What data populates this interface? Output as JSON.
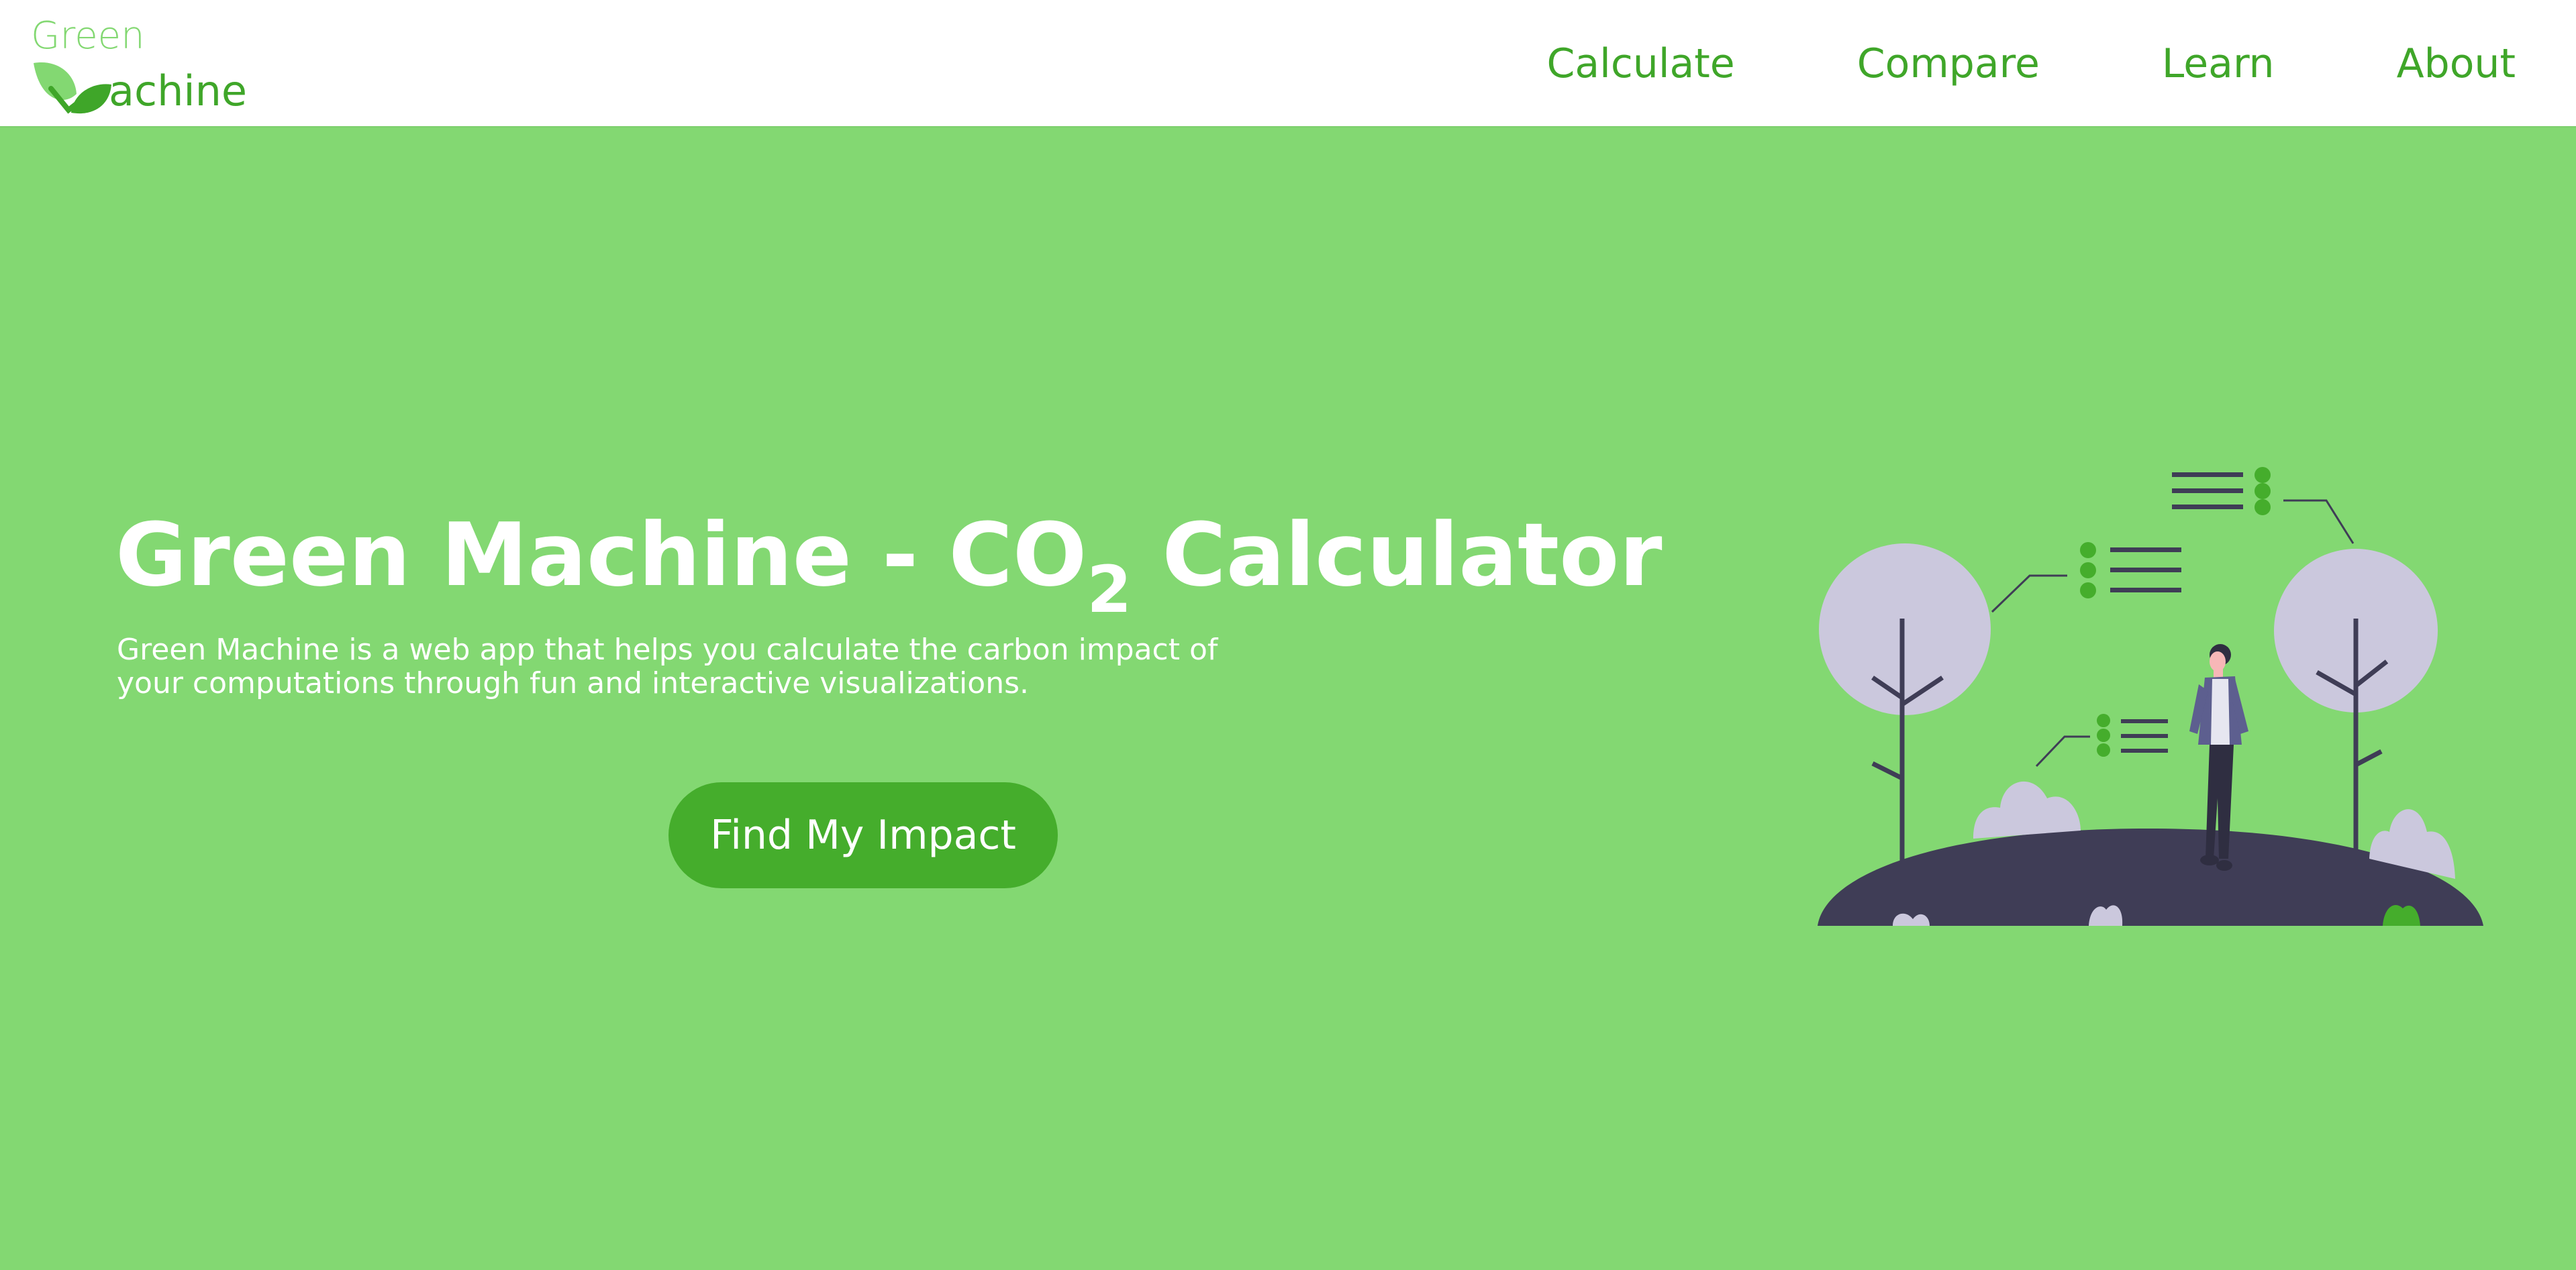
{
  "brand": {
    "name_top": "Green",
    "name_bottom": "achine",
    "colors": {
      "light": "#83d872",
      "dark": "#3fa629"
    }
  },
  "nav": {
    "items": [
      {
        "label": "Calculate"
      },
      {
        "label": "Compare"
      },
      {
        "label": "Learn"
      },
      {
        "label": "About"
      }
    ]
  },
  "hero": {
    "title_main": "Green Machine - CO",
    "title_sub": "2",
    "title_end": " Calculator",
    "description": "Green Machine is a web app that helps you calculate the carbon impact of your computations through fun and interactive visualizations.",
    "cta_label": "Find My Impact",
    "background_color": "#83d872",
    "button_color": "#45ad2c"
  },
  "illustration": {
    "icon": "person-in-park-illustration",
    "palette": {
      "ground": "#3f3d56",
      "foliage": "#cbc8dd",
      "accent": "#45ad2c"
    }
  }
}
